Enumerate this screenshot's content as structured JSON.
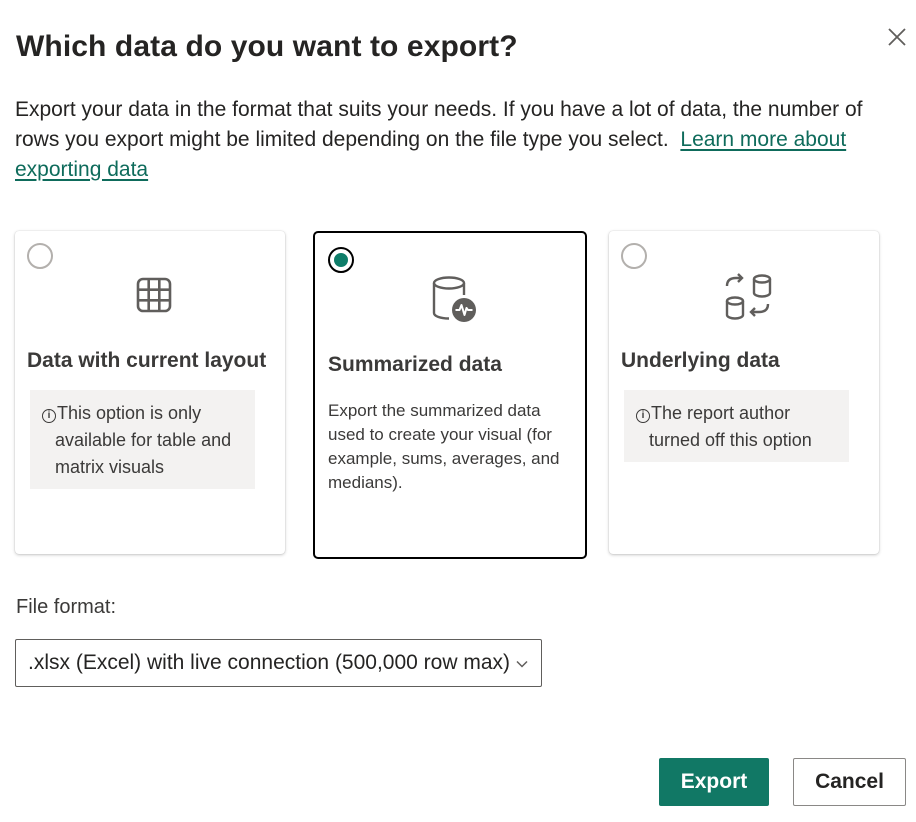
{
  "dialog": {
    "title": "Which data do you want to export?",
    "description": "Export your data in the format that suits your needs. If you have a lot of data, the number of rows you export might be limited depending on the file type you select.",
    "learn_more": "Learn more about exporting data",
    "close_icon": "close-icon"
  },
  "options": [
    {
      "title": "Data with current layout",
      "icon": "table-grid-icon",
      "selected": false,
      "note_line1": "This option is only",
      "note_line2": "available for table and",
      "note_line3": "matrix visuals"
    },
    {
      "title": "Summarized data",
      "icon": "database-pulse-icon",
      "selected": true,
      "description": "Export the summarized data used to create your visual (for example, sums, averages, and medians)."
    },
    {
      "title": "Underlying data",
      "icon": "data-exchange-icon",
      "selected": false,
      "note_line1": "The report author",
      "note_line2": "turned off this option"
    }
  ],
  "file_format": {
    "label": "File format:",
    "value": ".xlsx (Excel) with live connection (500,000 row max)"
  },
  "buttons": {
    "export": "Export",
    "cancel": "Cancel"
  },
  "colors": {
    "accent": "#117865",
    "link": "#0e6b5b",
    "note_bg": "#f3f2f1"
  }
}
